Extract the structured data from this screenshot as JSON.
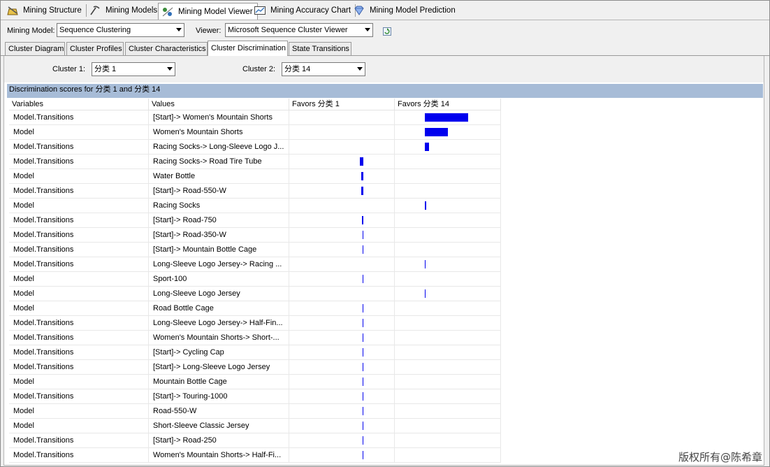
{
  "designer_tabs": [
    {
      "label": "Mining Structure",
      "icon": "mining-structure-icon"
    },
    {
      "label": "Mining Models",
      "icon": "mining-models-icon"
    },
    {
      "label": "Mining Model Viewer",
      "icon": "mining-model-viewer-icon",
      "active": true
    },
    {
      "label": "Mining Accuracy Chart",
      "icon": "accuracy-chart-icon"
    },
    {
      "label": "Mining Model Prediction",
      "icon": "diamond-icon"
    }
  ],
  "toolbar": {
    "mining_model_label": "Mining Model:",
    "mining_model_value": "Sequence Clustering",
    "viewer_label": "Viewer:",
    "viewer_value": "Microsoft Sequence Cluster Viewer"
  },
  "sub_tabs": [
    {
      "label": "Cluster Diagram"
    },
    {
      "label": "Cluster Profiles"
    },
    {
      "label": "Cluster Characteristics"
    },
    {
      "label": "Cluster Discrimination",
      "active": true
    },
    {
      "label": "State Transitions"
    }
  ],
  "cluster_select": {
    "cluster1_label": "Cluster 1:",
    "cluster1_value": "分类 1",
    "cluster2_label": "Cluster 2:",
    "cluster2_value": "分类 14"
  },
  "discrimination": {
    "title": "Discrimination scores for 分类 1 and 分类 14",
    "columns": [
      "Variables",
      "Values",
      "Favors 分类 1",
      "Favors 分类 14"
    ],
    "rows": [
      {
        "variable": "Model.Transitions",
        "value": "[Start]-> Women's Mountain Shorts",
        "side": 2,
        "score": 1.0
      },
      {
        "variable": "Model",
        "value": "Women's Mountain Shorts",
        "side": 2,
        "score": 0.53
      },
      {
        "variable": "Model.Transitions",
        "value": "Racing Socks-> Long-Sleeve Logo J...",
        "side": 2,
        "score": 0.1
      },
      {
        "variable": "Model.Transitions",
        "value": "Racing Socks-> Road Tire Tube",
        "side": 1,
        "score": 0.08
      },
      {
        "variable": "Model",
        "value": "Water Bottle",
        "side": 1,
        "score": 0.05
      },
      {
        "variable": "Model.Transitions",
        "value": "[Start]-> Road-550-W",
        "side": 1,
        "score": 0.05
      },
      {
        "variable": "Model",
        "value": "Racing Socks",
        "side": 2,
        "score": 0.04
      },
      {
        "variable": "Model.Transitions",
        "value": "[Start]-> Road-750",
        "side": 1,
        "score": 0.03
      },
      {
        "variable": "Model.Transitions",
        "value": "[Start]-> Road-350-W",
        "side": 1,
        "score": 0.02
      },
      {
        "variable": "Model.Transitions",
        "value": "[Start]-> Mountain Bottle Cage",
        "side": 1,
        "score": 0.02
      },
      {
        "variable": "Model.Transitions",
        "value": "Long-Sleeve Logo Jersey-> Racing ...",
        "side": 2,
        "score": 0.02
      },
      {
        "variable": "Model",
        "value": "Sport-100",
        "side": 1,
        "score": 0.02
      },
      {
        "variable": "Model",
        "value": "Long-Sleeve Logo Jersey",
        "side": 2,
        "score": 0.02
      },
      {
        "variable": "Model",
        "value": "Road Bottle Cage",
        "side": 1,
        "score": 0.02
      },
      {
        "variable": "Model.Transitions",
        "value": "Long-Sleeve Logo Jersey-> Half-Fin...",
        "side": 1,
        "score": 0.02
      },
      {
        "variable": "Model.Transitions",
        "value": "Women's Mountain Shorts-> Short-...",
        "side": 1,
        "score": 0.02
      },
      {
        "variable": "Model.Transitions",
        "value": "[Start]-> Cycling Cap",
        "side": 1,
        "score": 0.02
      },
      {
        "variable": "Model.Transitions",
        "value": "[Start]-> Long-Sleeve Logo Jersey",
        "side": 1,
        "score": 0.02
      },
      {
        "variable": "Model",
        "value": "Mountain Bottle Cage",
        "side": 1,
        "score": 0.02
      },
      {
        "variable": "Model.Transitions",
        "value": "[Start]-> Touring-1000",
        "side": 1,
        "score": 0.02
      },
      {
        "variable": "Model",
        "value": "Road-550-W",
        "side": 1,
        "score": 0.02
      },
      {
        "variable": "Model",
        "value": "Short-Sleeve Classic Jersey",
        "side": 1,
        "score": 0.02
      },
      {
        "variable": "Model.Transitions",
        "value": "[Start]-> Road-250",
        "side": 1,
        "score": 0.02
      },
      {
        "variable": "Model.Transitions",
        "value": "Women's Mountain Shorts-> Half-Fi...",
        "side": 1,
        "score": 0.02
      }
    ]
  },
  "watermark": "版权所有@陈希章",
  "colors": {
    "bar": "#0000ee",
    "header_bar": "#a7bcd7"
  }
}
